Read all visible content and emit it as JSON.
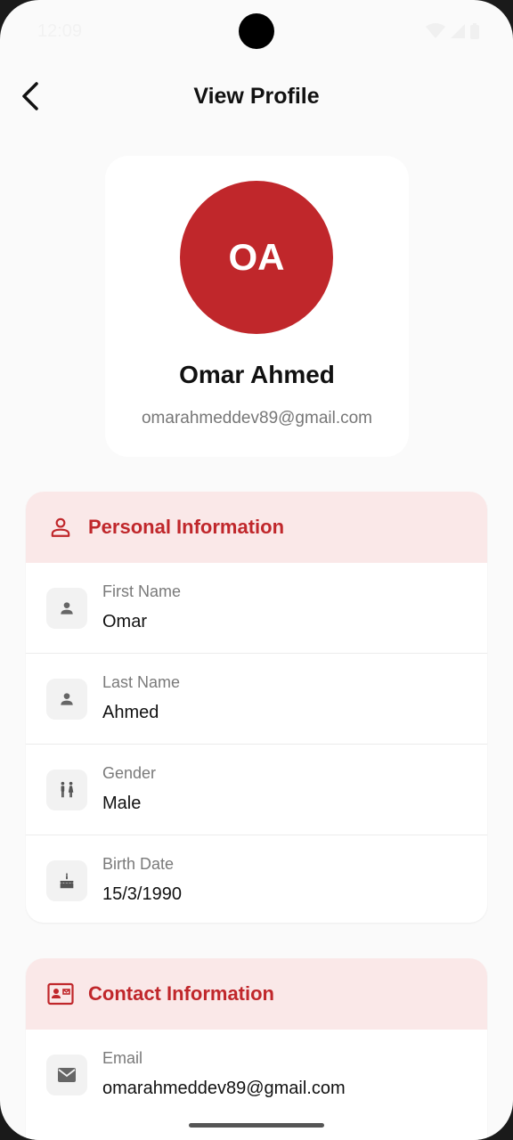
{
  "status_bar": {
    "time": "12:09"
  },
  "app_bar": {
    "title": "View Profile"
  },
  "profile": {
    "initials": "OA",
    "name": "Omar Ahmed",
    "email": "omarahmeddev89@gmail.com",
    "avatar_color": "#c0272b"
  },
  "personal": {
    "title": "Personal Information",
    "icon": "person-outline-icon",
    "rows": [
      {
        "icon": "person-icon",
        "label": "First Name",
        "value": "Omar"
      },
      {
        "icon": "person-icon",
        "label": "Last Name",
        "value": "Ahmed"
      },
      {
        "icon": "wc-icon",
        "label": "Gender",
        "value": "Male"
      },
      {
        "icon": "cake-icon",
        "label": "Birth Date",
        "value": "15/3/1990"
      }
    ]
  },
  "contact": {
    "title": "Contact Information",
    "icon": "contact-card-icon",
    "rows": [
      {
        "icon": "email-icon",
        "label": "Email",
        "value": "omarahmeddev89@gmail.com"
      }
    ]
  },
  "colors": {
    "accent": "#c0272b",
    "section_header_bg": "#fae8e8",
    "background": "#fafafa"
  }
}
